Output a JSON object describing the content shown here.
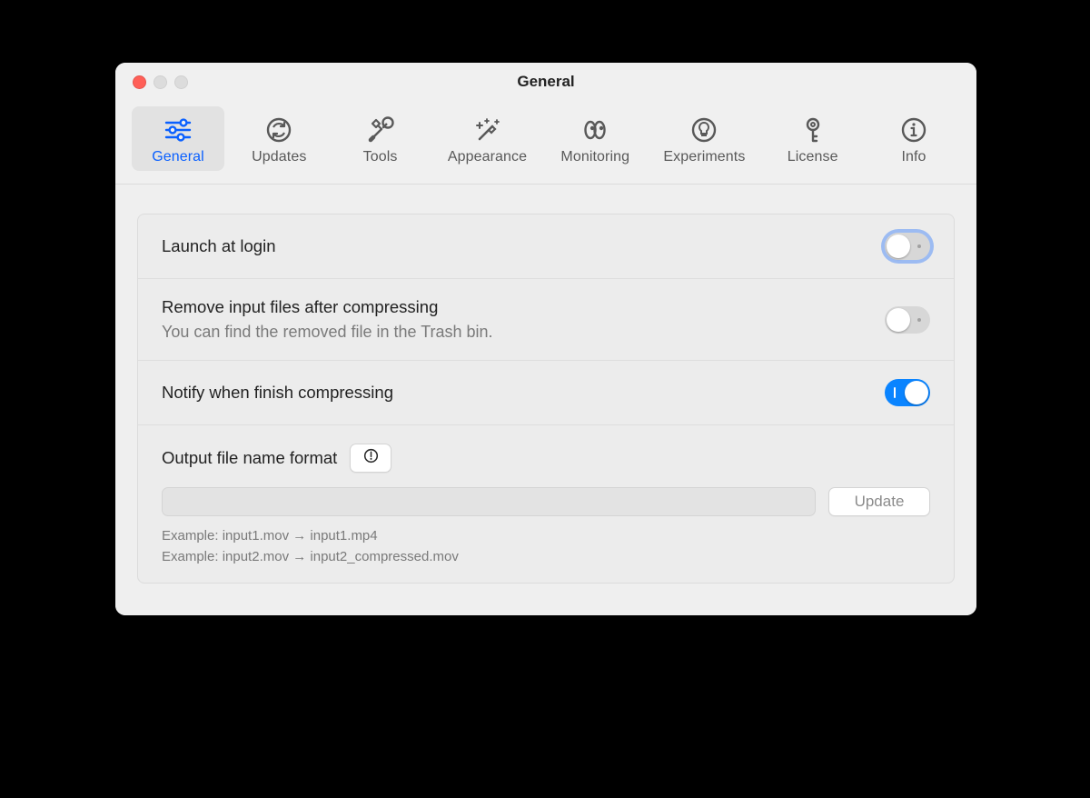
{
  "window": {
    "title": "General"
  },
  "tabs": {
    "general": "General",
    "updates": "Updates",
    "tools": "Tools",
    "appearance": "Appearance",
    "monitoring": "Monitoring",
    "experiments": "Experiments",
    "license": "License",
    "info": "Info"
  },
  "settings": {
    "launch_at_login": {
      "label": "Launch at login",
      "value": false
    },
    "remove_input": {
      "label": "Remove input files after compressing",
      "sub": "You can find the removed file in the Trash bin.",
      "value": false
    },
    "notify": {
      "label": "Notify when finish compressing",
      "value": true
    },
    "output": {
      "label": "Output file name format",
      "value": "",
      "update_label": "Update",
      "example1": "Example: input1.mov → input1.mp4",
      "example2": "Example: input2.mov → input2_compressed.mov"
    }
  }
}
